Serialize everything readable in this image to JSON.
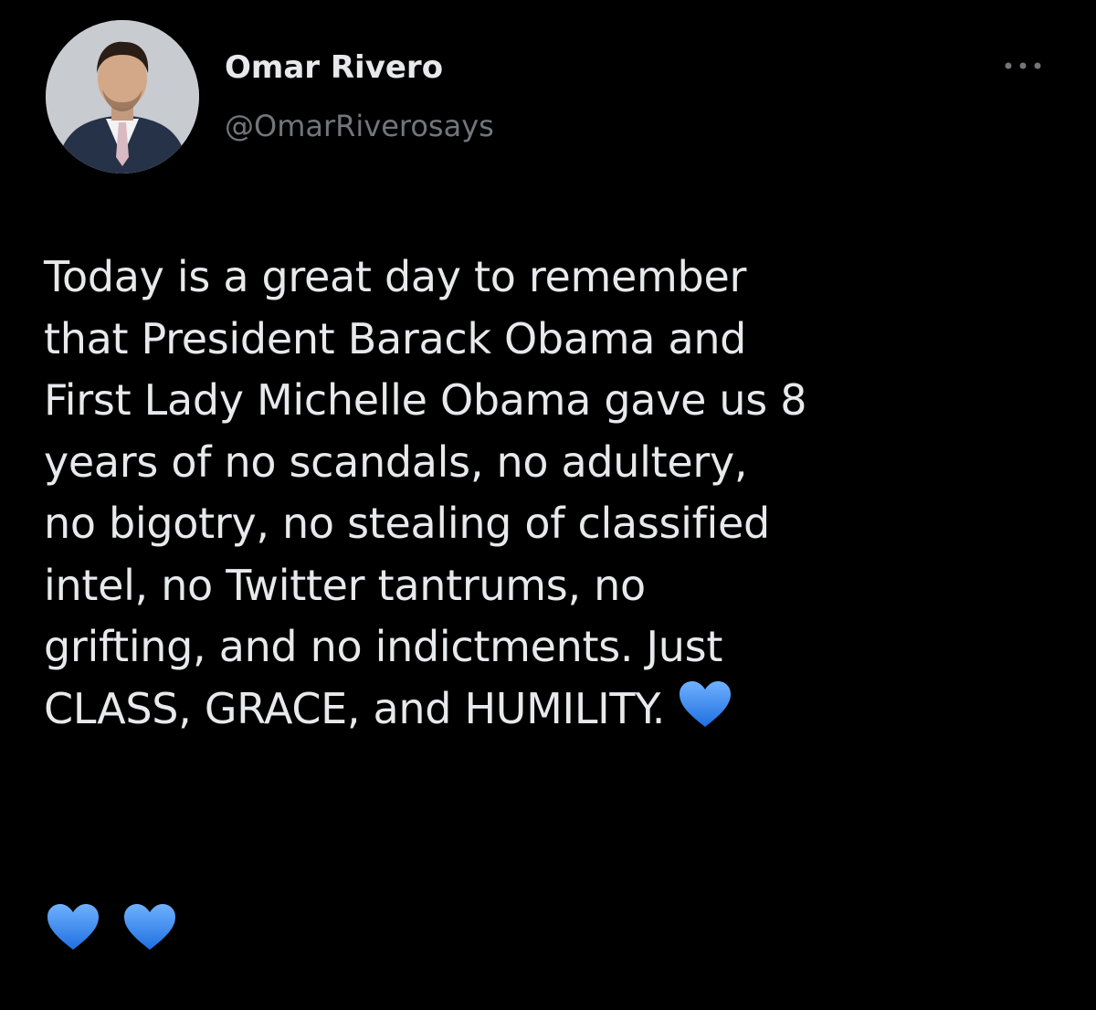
{
  "author": {
    "name": "Omar Rivero",
    "handle": "@OmarRiverosays"
  },
  "tweet": {
    "lines": [
      "Today is a great day to remember",
      "that President Barack Obama and",
      "First Lady Michelle Obama gave us 8",
      "years of no scandals, no adultery,",
      "no bigotry, no stealing of classified",
      "intel, no Twitter tantrums, no",
      "grifting, and no indictments. Just",
      "CLASS, GRACE, and HUMILITY."
    ],
    "emoji": [
      "blue-heart",
      "blue-heart",
      "blue-heart"
    ]
  },
  "icons": {
    "more": "more-horizontal-icon",
    "heart": "blue-heart-icon"
  },
  "colors": {
    "background": "#000000",
    "text": "#e7e9ea",
    "secondary_text": "#71767b",
    "heart": "#3b8ff0"
  }
}
